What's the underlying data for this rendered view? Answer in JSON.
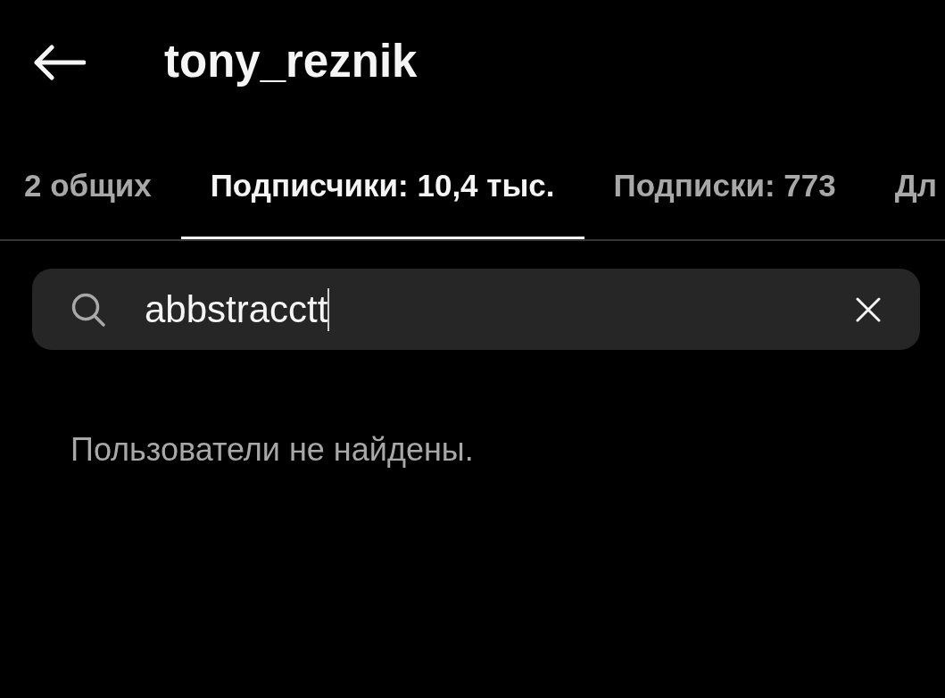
{
  "header": {
    "title": "tony_reznik"
  },
  "tabs": [
    {
      "label": "2 общих",
      "selected": false
    },
    {
      "label": "Подписчики: 10,4 тыс.",
      "selected": true
    },
    {
      "label": "Подписки: 773",
      "selected": false
    },
    {
      "label": "Дл",
      "selected": false
    }
  ],
  "search": {
    "value": "abbstracctt",
    "focused": true
  },
  "empty_message": "Пользователи не найдены."
}
